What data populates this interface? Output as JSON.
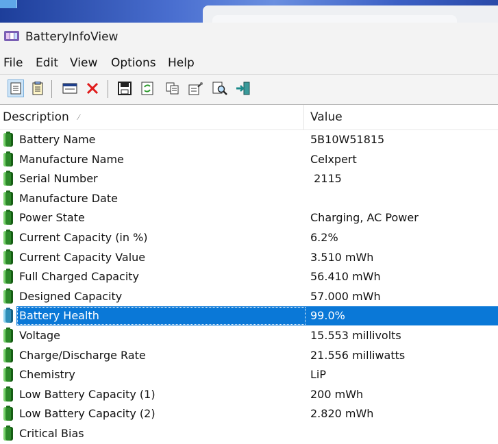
{
  "window": {
    "title": "BatteryInfoView"
  },
  "menu": [
    "File",
    "Edit",
    "View",
    "Options",
    "Help"
  ],
  "toolbar": [
    "properties-icon",
    "report-icon",
    "html-report-icon",
    "delete-icon",
    "save-icon",
    "refresh-icon",
    "copy-icon",
    "options-icon",
    "find-icon",
    "exit-icon"
  ],
  "columns": {
    "description": "Description",
    "value": "Value"
  },
  "selected_row_index": 9,
  "colors": {
    "selection": "#0a78d7",
    "battery_icon": "#2d8a2a"
  },
  "rows": [
    {
      "description": "Battery Name",
      "value": "5B10W51815"
    },
    {
      "description": "Manufacture Name",
      "value": "Celxpert"
    },
    {
      "description": "Serial Number",
      "value": " 2115"
    },
    {
      "description": "Manufacture Date",
      "value": ""
    },
    {
      "description": "Power State",
      "value": "Charging, AC Power"
    },
    {
      "description": "Current Capacity (in %)",
      "value": "6.2%"
    },
    {
      "description": "Current Capacity Value",
      "value": "3.510 mWh"
    },
    {
      "description": "Full Charged Capacity",
      "value": "56.410 mWh"
    },
    {
      "description": "Designed Capacity",
      "value": "57.000 mWh"
    },
    {
      "description": "Battery Health",
      "value": "99.0%"
    },
    {
      "description": "Voltage",
      "value": "15.553 millivolts"
    },
    {
      "description": "Charge/Discharge Rate",
      "value": "21.556 milliwatts"
    },
    {
      "description": "Chemistry",
      "value": "LiP"
    },
    {
      "description": "Low Battery Capacity (1)",
      "value": "200 mWh"
    },
    {
      "description": "Low Battery Capacity (2)",
      "value": "2.820 mWh"
    },
    {
      "description": "Critical Bias",
      "value": ""
    }
  ]
}
